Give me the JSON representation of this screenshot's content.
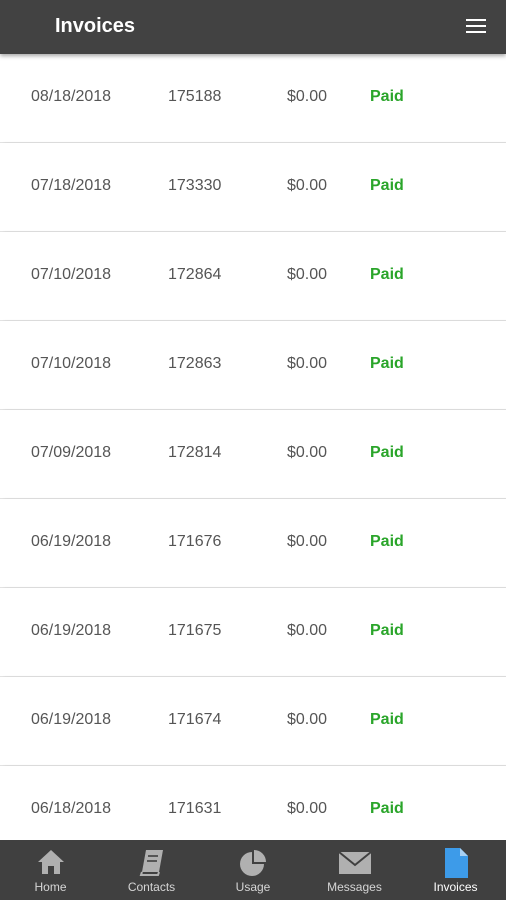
{
  "header": {
    "title": "Invoices"
  },
  "invoices": [
    {
      "date": "08/18/2018",
      "number": "175188",
      "amount": "$0.00",
      "status": "Paid"
    },
    {
      "date": "07/18/2018",
      "number": "173330",
      "amount": "$0.00",
      "status": "Paid"
    },
    {
      "date": "07/10/2018",
      "number": "172864",
      "amount": "$0.00",
      "status": "Paid"
    },
    {
      "date": "07/10/2018",
      "number": "172863",
      "amount": "$0.00",
      "status": "Paid"
    },
    {
      "date": "07/09/2018",
      "number": "172814",
      "amount": "$0.00",
      "status": "Paid"
    },
    {
      "date": "06/19/2018",
      "number": "171676",
      "amount": "$0.00",
      "status": "Paid"
    },
    {
      "date": "06/19/2018",
      "number": "171675",
      "amount": "$0.00",
      "status": "Paid"
    },
    {
      "date": "06/19/2018",
      "number": "171674",
      "amount": "$0.00",
      "status": "Paid"
    },
    {
      "date": "06/18/2018",
      "number": "171631",
      "amount": "$0.00",
      "status": "Paid"
    }
  ],
  "tabs": [
    {
      "label": "Home",
      "icon": "home-icon"
    },
    {
      "label": "Contacts",
      "icon": "contacts-book-icon"
    },
    {
      "label": "Usage",
      "icon": "pie-chart-icon"
    },
    {
      "label": "Messages",
      "icon": "envelope-icon"
    },
    {
      "label": "Invoices",
      "icon": "document-icon",
      "active": true
    }
  ],
  "colors": {
    "app_bar": "#424242",
    "tab_bar": "#404040",
    "status_paid": "#2aa52a",
    "active_tab_icon": "#3d9be9",
    "inactive_tab_icon": "#b0b0b0"
  }
}
